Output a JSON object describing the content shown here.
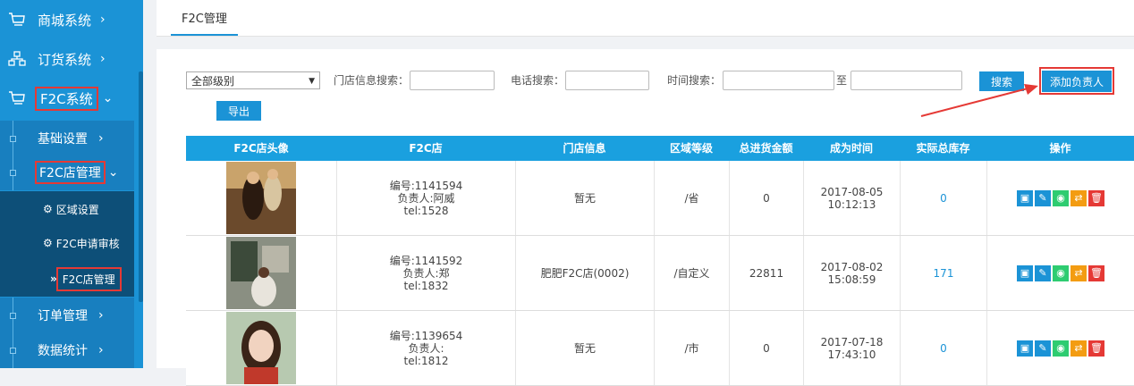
{
  "sidebar": {
    "top": [
      {
        "label": "商城系统",
        "icon": "cart-icon"
      },
      {
        "label": "订货系统",
        "icon": "hierarchy-icon"
      },
      {
        "label": "F2C系统",
        "icon": "cart-icon"
      }
    ],
    "sub": [
      {
        "label": "基础设置"
      },
      {
        "label": "F2C店管理"
      }
    ],
    "third": [
      {
        "label": "区域设置",
        "icon": "gear-icon"
      },
      {
        "label": "F2C申请审核",
        "icon": "gear-icon"
      },
      {
        "label": "F2C店管理",
        "icon": "double-chevron-icon"
      }
    ],
    "bottom": [
      {
        "label": "订单管理"
      },
      {
        "label": "数据统计"
      }
    ]
  },
  "tab": {
    "label": "F2C管理"
  },
  "filters": {
    "level_select": "全部级别",
    "store_search_label": "门店信息搜索：",
    "phone_search_label": "电话搜索：",
    "time_search_label": "时间搜索：",
    "to_label": "至",
    "search_button": "搜索",
    "add_button": "添加负责人",
    "export_button": "导出"
  },
  "table": {
    "headers": [
      "F2C店头像",
      "F2C店",
      "门店信息",
      "区域等级",
      "总进货金额",
      "成为时间",
      "实际总库存",
      "操作"
    ],
    "rows": [
      {
        "id": "编号:1141594",
        "owner": "负责人:阿威",
        "tel": "tel:1528",
        "store_info": "暂无",
        "level": "/省",
        "amount": "0",
        "date": "2017-08-05",
        "time": "10:12:13",
        "stock": "0"
      },
      {
        "id": "编号:1141592",
        "owner": "负责人:郑",
        "tel": "tel:1832",
        "store_info": "肥肥F2C店(0002)",
        "level": "/自定义",
        "amount": "22811",
        "date": "2017-08-02",
        "time": "15:08:59",
        "stock": "171"
      },
      {
        "id": "编号:1139654",
        "owner": "负责人:",
        "tel": "tel:1812",
        "store_info": "暂无",
        "level": "/市",
        "amount": "0",
        "date": "2017-07-18",
        "time": "17:43:10",
        "stock": "0"
      }
    ]
  },
  "colors": {
    "primary": "#1b93d6",
    "highlight": "#e53935",
    "op_blue": "#1b93d6",
    "op_green": "#2ecc71",
    "op_orange": "#f39c12",
    "op_red": "#e53935"
  }
}
